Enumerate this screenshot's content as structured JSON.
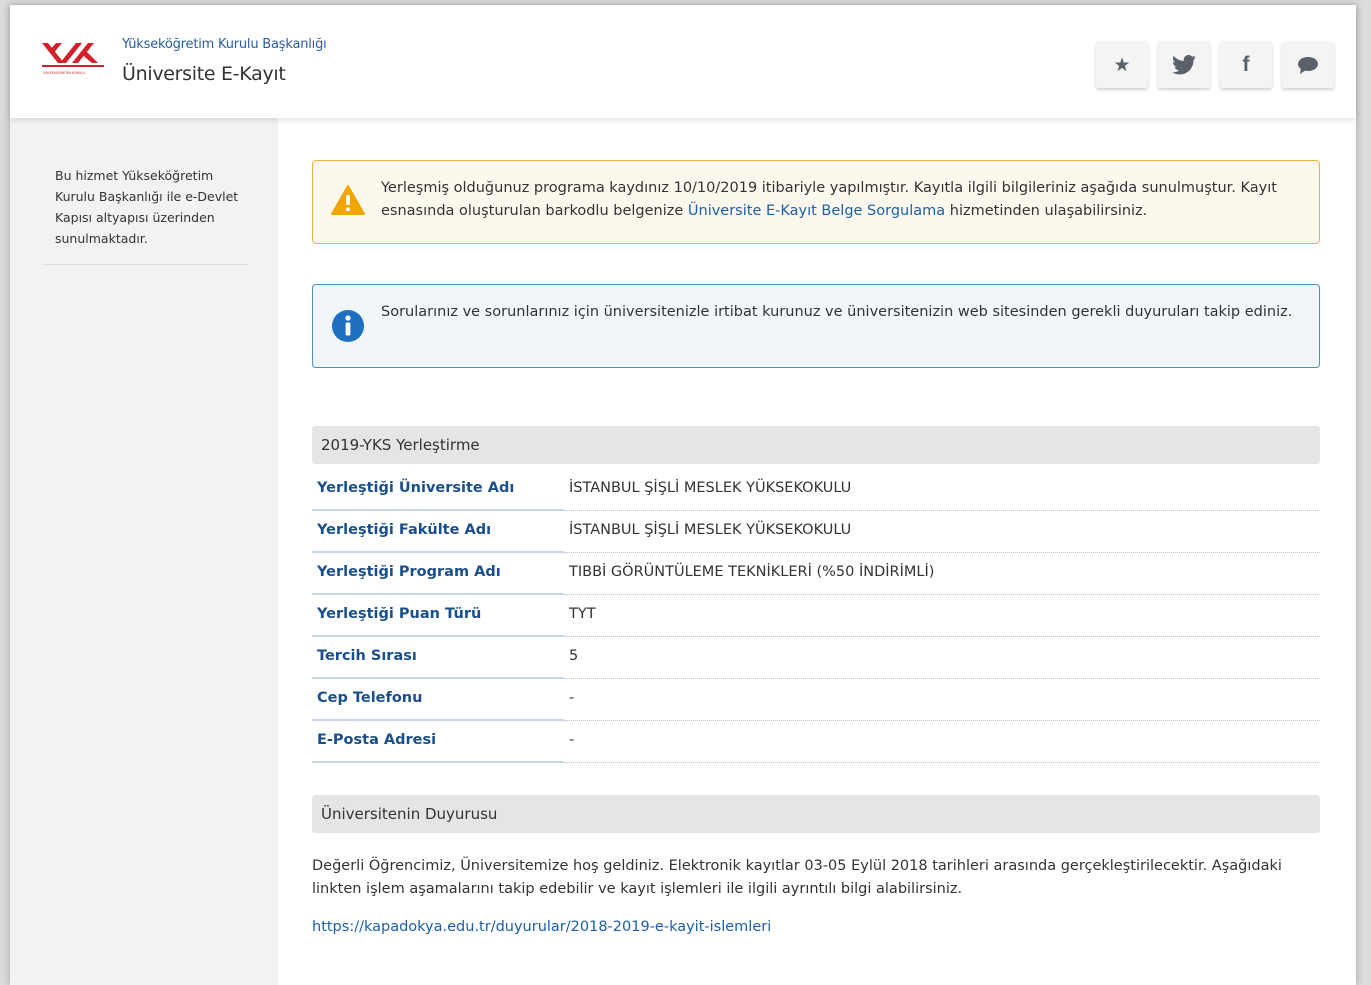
{
  "header": {
    "org_name": "Yükseköğretim Kurulu Başkanlığı",
    "service_name": "Üniversite E-Kayıt",
    "logo_caption": "YÜKSEKÖĞRETİM KURULU",
    "buttons": [
      {
        "icon": "star-icon",
        "glyph": "★"
      },
      {
        "icon": "twitter-icon",
        "glyph": "🐦"
      },
      {
        "icon": "facebook-icon",
        "glyph": "f"
      },
      {
        "icon": "comment-icon",
        "glyph": "💬"
      }
    ]
  },
  "sidebar": {
    "text": "Bu hizmet Yükseköğretim Kurulu Başkanlığı ile e-Devlet Kapısı altyapısı üzerinden sunulmaktadır."
  },
  "alerts": {
    "warning_text_before": "Yerleşmiş olduğunuz programa kaydınız 10/10/2019 itibariyle yapılmıştır. Kayıtla ilgili bilgileriniz aşağıda sunulmuştur. Kayıt esnasında oluşturulan barkodlu belgenize ",
    "warning_link": "Üniversite E-Kayıt Belge Sorgulama",
    "warning_text_after": " hizmetinden ulaşabilirsiniz.",
    "info_text": "Sorularınız ve sorunlarınız için üniversitenizle irtibat kurunuz ve üniversitenizin web sitesinden gerekli duyuruları takip ediniz."
  },
  "placement": {
    "section_title": "2019-YKS Yerleştirme",
    "rows": [
      {
        "label": "Yerleştiği Üniversite Adı",
        "value": "İSTANBUL ŞİŞLİ MESLEK YÜKSEKOKULU"
      },
      {
        "label": "Yerleştiği Fakülte Adı",
        "value": "İSTANBUL ŞİŞLİ MESLEK YÜKSEKOKULU"
      },
      {
        "label": "Yerleştiği Program Adı",
        "value": "TIBBİ GÖRÜNTÜLEME TEKNİKLERİ (%50 İNDİRİMLİ)"
      },
      {
        "label": "Yerleştiği Puan Türü",
        "value": "TYT"
      },
      {
        "label": "Tercih Sırası",
        "value": "5"
      },
      {
        "label": "Cep Telefonu",
        "value": "-"
      },
      {
        "label": "E-Posta Adresi",
        "value": "-"
      }
    ]
  },
  "announcement": {
    "section_title": "Üniversitenin Duyurusu",
    "text": "Değerli Öğrencimiz, Üniversitemize hoş geldiniz. Elektronik kayıtlar 03-05 Eylül 2018 tarihleri arasında gerçekleştirilecektir. Aşağıdaki linkten işlem aşamalarını takip edebilir ve kayıt işlemleri ile ilgili ayrıntılı bilgi alabilirsiniz.",
    "link": "https://kapadokya.edu.tr/duyurular/2018-2019-e-kayit-islemleri"
  },
  "colors": {
    "accent_blue": "#1a4f8b",
    "link_blue": "#1c5fa8",
    "warning_orange": "#f0a500",
    "info_blue": "#1e6fc0",
    "logo_red": "#d4202a"
  }
}
